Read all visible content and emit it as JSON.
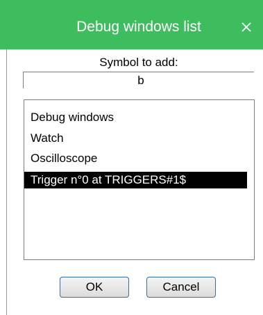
{
  "window": {
    "title": "Debug windows list",
    "close_icon": "close-icon",
    "title_bar_color": "#3dbd5e"
  },
  "symbol": {
    "label": "Symbol to add:",
    "value": "b"
  },
  "list": {
    "items": [
      {
        "label": "Debug windows",
        "selected": false
      },
      {
        "label": "Watch",
        "selected": false
      },
      {
        "label": "Oscilloscope",
        "selected": false
      },
      {
        "label": "Trigger n°0 at TRIGGERS#1$",
        "selected": true
      }
    ]
  },
  "buttons": {
    "ok_label": "OK",
    "cancel_label": "Cancel"
  }
}
